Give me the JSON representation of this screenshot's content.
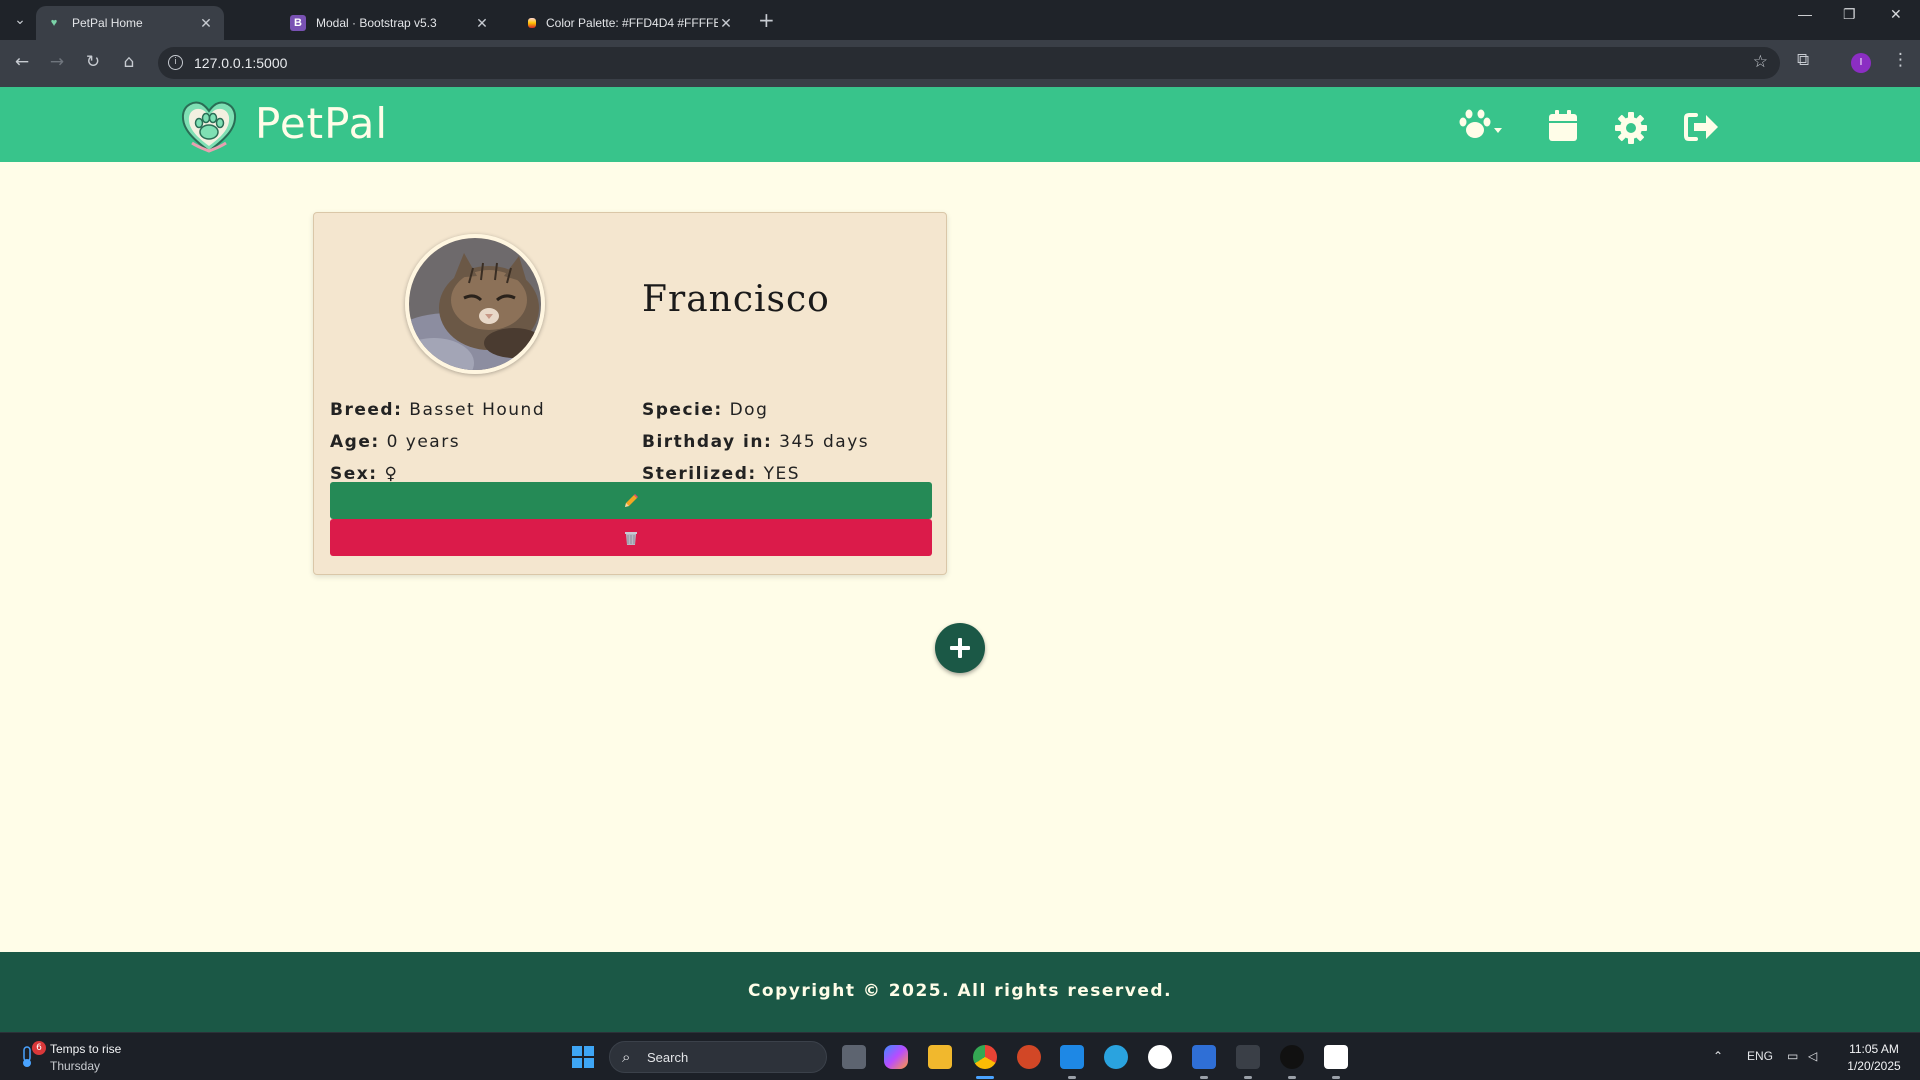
{
  "browser": {
    "tabs": [
      {
        "title": "PetPal Home",
        "active": true
      },
      {
        "title": "Modal · Bootstrap v5.3",
        "active": false
      },
      {
        "title": "Color Palette: #FFD4D4 #FFFFE",
        "active": false
      }
    ],
    "url": "127.0.0.1:5000",
    "profile_initial": "I"
  },
  "navbar": {
    "brand": "PetPal",
    "icons": [
      "paw-icon",
      "calendar-icon",
      "gear-icon",
      "logout-icon"
    ]
  },
  "pet": {
    "name": "Francisco",
    "breed_label": "Breed:",
    "breed": "Basset Hound",
    "age_label": "Age:",
    "age": "0 years",
    "sex_label": "Sex:",
    "sex_symbol": "♀",
    "specie_label": "Specie:",
    "specie": "Dog",
    "birthday_label": "Birthday in:",
    "birthday": "345 days",
    "sterilized_label": "Sterilized:",
    "sterilized": "YES"
  },
  "actions": {
    "edit_icon": "pencil-icon",
    "delete_icon": "trash-icon",
    "add_icon": "plus-icon"
  },
  "footer": {
    "copyright": "Copyright © 2025. All rights reserved."
  },
  "taskbar": {
    "weather_badge": "6",
    "weather_line1": "Temps to rise",
    "weather_line2": "Thursday",
    "search_placeholder": "Search",
    "lang": "ENG",
    "time": "11:05 AM",
    "date": "1/20/2025"
  },
  "colors": {
    "navbar": "#38C48B",
    "page_bg": "#FFFDE8",
    "card_bg": "#F4E6CF",
    "edit_button": "#258A56",
    "delete_button": "#DB1B4A",
    "footer": "#1B5846"
  }
}
